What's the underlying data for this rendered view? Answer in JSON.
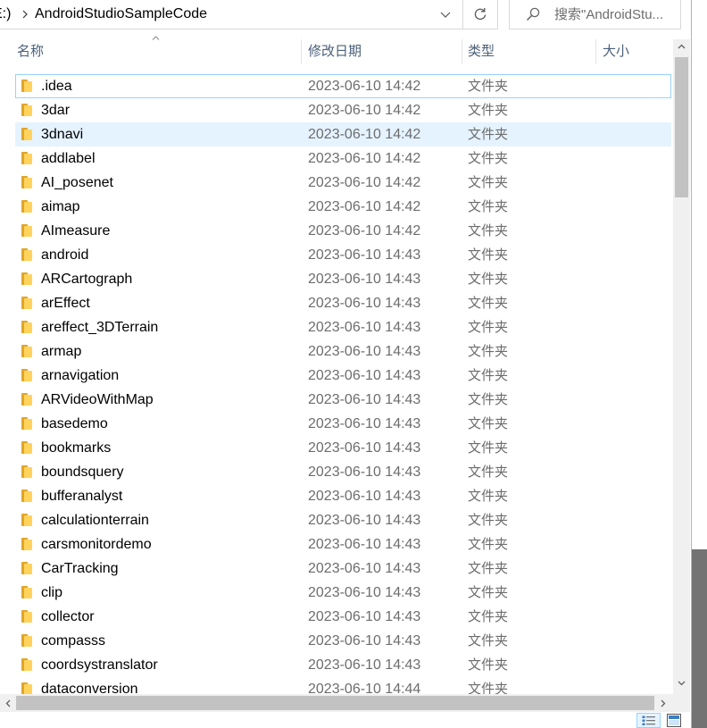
{
  "address_bar": {
    "drive": "E:)",
    "current_folder": "AndroidStudioSampleCode"
  },
  "search": {
    "placeholder": "搜索\"AndroidStu..."
  },
  "columns": {
    "name": "名称",
    "modified": "修改日期",
    "type": "类型",
    "size": "大小"
  },
  "rows": [
    {
      "name": ".idea",
      "modified": "2023-06-10 14:42",
      "type": "文件夹"
    },
    {
      "name": "3dar",
      "modified": "2023-06-10 14:42",
      "type": "文件夹"
    },
    {
      "name": "3dnavi",
      "modified": "2023-06-10 14:42",
      "type": "文件夹"
    },
    {
      "name": "addlabel",
      "modified": "2023-06-10 14:42",
      "type": "文件夹"
    },
    {
      "name": "AI_posenet",
      "modified": "2023-06-10 14:42",
      "type": "文件夹"
    },
    {
      "name": "aimap",
      "modified": "2023-06-10 14:42",
      "type": "文件夹"
    },
    {
      "name": "AImeasure",
      "modified": "2023-06-10 14:42",
      "type": "文件夹"
    },
    {
      "name": "android",
      "modified": "2023-06-10 14:43",
      "type": "文件夹"
    },
    {
      "name": "ARCartograph",
      "modified": "2023-06-10 14:43",
      "type": "文件夹"
    },
    {
      "name": "arEffect",
      "modified": "2023-06-10 14:43",
      "type": "文件夹"
    },
    {
      "name": "areffect_3DTerrain",
      "modified": "2023-06-10 14:43",
      "type": "文件夹"
    },
    {
      "name": "armap",
      "modified": "2023-06-10 14:43",
      "type": "文件夹"
    },
    {
      "name": "arnavigation",
      "modified": "2023-06-10 14:43",
      "type": "文件夹"
    },
    {
      "name": "ARVideoWithMap",
      "modified": "2023-06-10 14:43",
      "type": "文件夹"
    },
    {
      "name": "basedemo",
      "modified": "2023-06-10 14:43",
      "type": "文件夹"
    },
    {
      "name": "bookmarks",
      "modified": "2023-06-10 14:43",
      "type": "文件夹"
    },
    {
      "name": "boundsquery",
      "modified": "2023-06-10 14:43",
      "type": "文件夹"
    },
    {
      "name": "bufferanalyst",
      "modified": "2023-06-10 14:43",
      "type": "文件夹"
    },
    {
      "name": "calculationterrain",
      "modified": "2023-06-10 14:43",
      "type": "文件夹"
    },
    {
      "name": "carsmonitordemo",
      "modified": "2023-06-10 14:43",
      "type": "文件夹"
    },
    {
      "name": "CarTracking",
      "modified": "2023-06-10 14:43",
      "type": "文件夹"
    },
    {
      "name": "clip",
      "modified": "2023-06-10 14:43",
      "type": "文件夹"
    },
    {
      "name": "collector",
      "modified": "2023-06-10 14:43",
      "type": "文件夹"
    },
    {
      "name": "compasss",
      "modified": "2023-06-10 14:43",
      "type": "文件夹"
    },
    {
      "name": "coordsystranslator",
      "modified": "2023-06-10 14:43",
      "type": "文件夹"
    },
    {
      "name": "dataconversion",
      "modified": "2023-06-10 14:44",
      "type": "文件夹"
    }
  ],
  "icons": {
    "breadcrumb_separator": "chevron-right-icon",
    "address_dropdown": "chevron-down-icon",
    "refresh": "refresh-icon",
    "search": "search-icon",
    "sort_indicator": "sort-ascending-icon",
    "folder": "folder-icon",
    "view_details": "details-view-icon",
    "view_large_icons": "large-icons-view-icon"
  },
  "colors": {
    "hover_row_bg": "#e5f3ff",
    "focus_row_outline": "#99d1ff",
    "header_text": "#4c607a",
    "secondary_text": "#6d6d6d",
    "folder_front": "#ffd35c",
    "folder_back": "#e0a52a",
    "scrollbar_thumb": "#c2c2c2",
    "scrollbar_track": "#f0f0f0"
  }
}
